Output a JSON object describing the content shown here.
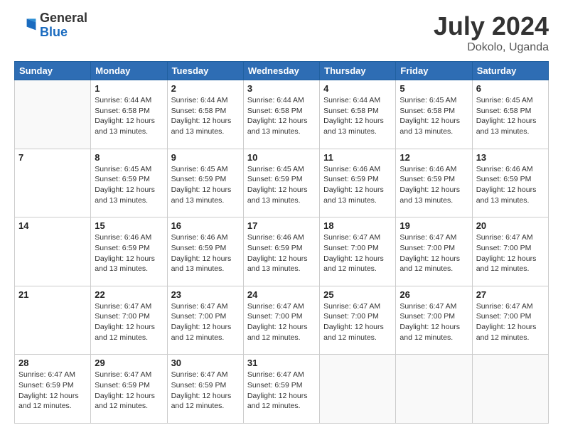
{
  "logo": {
    "general": "General",
    "blue": "Blue"
  },
  "title": {
    "month_year": "July 2024",
    "location": "Dokolo, Uganda"
  },
  "days_of_week": [
    "Sunday",
    "Monday",
    "Tuesday",
    "Wednesday",
    "Thursday",
    "Friday",
    "Saturday"
  ],
  "weeks": [
    [
      {
        "day": "",
        "info": ""
      },
      {
        "day": "1",
        "info": "Sunrise: 6:44 AM\nSunset: 6:58 PM\nDaylight: 12 hours\nand 13 minutes."
      },
      {
        "day": "2",
        "info": "Sunrise: 6:44 AM\nSunset: 6:58 PM\nDaylight: 12 hours\nand 13 minutes."
      },
      {
        "day": "3",
        "info": "Sunrise: 6:44 AM\nSunset: 6:58 PM\nDaylight: 12 hours\nand 13 minutes."
      },
      {
        "day": "4",
        "info": "Sunrise: 6:44 AM\nSunset: 6:58 PM\nDaylight: 12 hours\nand 13 minutes."
      },
      {
        "day": "5",
        "info": "Sunrise: 6:45 AM\nSunset: 6:58 PM\nDaylight: 12 hours\nand 13 minutes."
      },
      {
        "day": "6",
        "info": "Sunrise: 6:45 AM\nSunset: 6:58 PM\nDaylight: 12 hours\nand 13 minutes."
      }
    ],
    [
      {
        "day": "7",
        "info": ""
      },
      {
        "day": "8",
        "info": "Sunrise: 6:45 AM\nSunset: 6:59 PM\nDaylight: 12 hours\nand 13 minutes."
      },
      {
        "day": "9",
        "info": "Sunrise: 6:45 AM\nSunset: 6:59 PM\nDaylight: 12 hours\nand 13 minutes."
      },
      {
        "day": "10",
        "info": "Sunrise: 6:45 AM\nSunset: 6:59 PM\nDaylight: 12 hours\nand 13 minutes."
      },
      {
        "day": "11",
        "info": "Sunrise: 6:46 AM\nSunset: 6:59 PM\nDaylight: 12 hours\nand 13 minutes."
      },
      {
        "day": "12",
        "info": "Sunrise: 6:46 AM\nSunset: 6:59 PM\nDaylight: 12 hours\nand 13 minutes."
      },
      {
        "day": "13",
        "info": "Sunrise: 6:46 AM\nSunset: 6:59 PM\nDaylight: 12 hours\nand 13 minutes."
      }
    ],
    [
      {
        "day": "14",
        "info": ""
      },
      {
        "day": "15",
        "info": "Sunrise: 6:46 AM\nSunset: 6:59 PM\nDaylight: 12 hours\nand 13 minutes."
      },
      {
        "day": "16",
        "info": "Sunrise: 6:46 AM\nSunset: 6:59 PM\nDaylight: 12 hours\nand 13 minutes."
      },
      {
        "day": "17",
        "info": "Sunrise: 6:46 AM\nSunset: 6:59 PM\nDaylight: 12 hours\nand 13 minutes."
      },
      {
        "day": "18",
        "info": "Sunrise: 6:47 AM\nSunset: 7:00 PM\nDaylight: 12 hours\nand 12 minutes."
      },
      {
        "day": "19",
        "info": "Sunrise: 6:47 AM\nSunset: 7:00 PM\nDaylight: 12 hours\nand 12 minutes."
      },
      {
        "day": "20",
        "info": "Sunrise: 6:47 AM\nSunset: 7:00 PM\nDaylight: 12 hours\nand 12 minutes."
      }
    ],
    [
      {
        "day": "21",
        "info": ""
      },
      {
        "day": "22",
        "info": "Sunrise: 6:47 AM\nSunset: 7:00 PM\nDaylight: 12 hours\nand 12 minutes."
      },
      {
        "day": "23",
        "info": "Sunrise: 6:47 AM\nSunset: 7:00 PM\nDaylight: 12 hours\nand 12 minutes."
      },
      {
        "day": "24",
        "info": "Sunrise: 6:47 AM\nSunset: 7:00 PM\nDaylight: 12 hours\nand 12 minutes."
      },
      {
        "day": "25",
        "info": "Sunrise: 6:47 AM\nSunset: 7:00 PM\nDaylight: 12 hours\nand 12 minutes."
      },
      {
        "day": "26",
        "info": "Sunrise: 6:47 AM\nSunset: 7:00 PM\nDaylight: 12 hours\nand 12 minutes."
      },
      {
        "day": "27",
        "info": "Sunrise: 6:47 AM\nSunset: 7:00 PM\nDaylight: 12 hours\nand 12 minutes."
      }
    ],
    [
      {
        "day": "28",
        "info": "Sunrise: 6:47 AM\nSunset: 6:59 PM\nDaylight: 12 hours\nand 12 minutes."
      },
      {
        "day": "29",
        "info": "Sunrise: 6:47 AM\nSunset: 6:59 PM\nDaylight: 12 hours\nand 12 minutes."
      },
      {
        "day": "30",
        "info": "Sunrise: 6:47 AM\nSunset: 6:59 PM\nDaylight: 12 hours\nand 12 minutes."
      },
      {
        "day": "31",
        "info": "Sunrise: 6:47 AM\nSunset: 6:59 PM\nDaylight: 12 hours\nand 12 minutes."
      },
      {
        "day": "",
        "info": ""
      },
      {
        "day": "",
        "info": ""
      },
      {
        "day": "",
        "info": ""
      }
    ]
  ]
}
